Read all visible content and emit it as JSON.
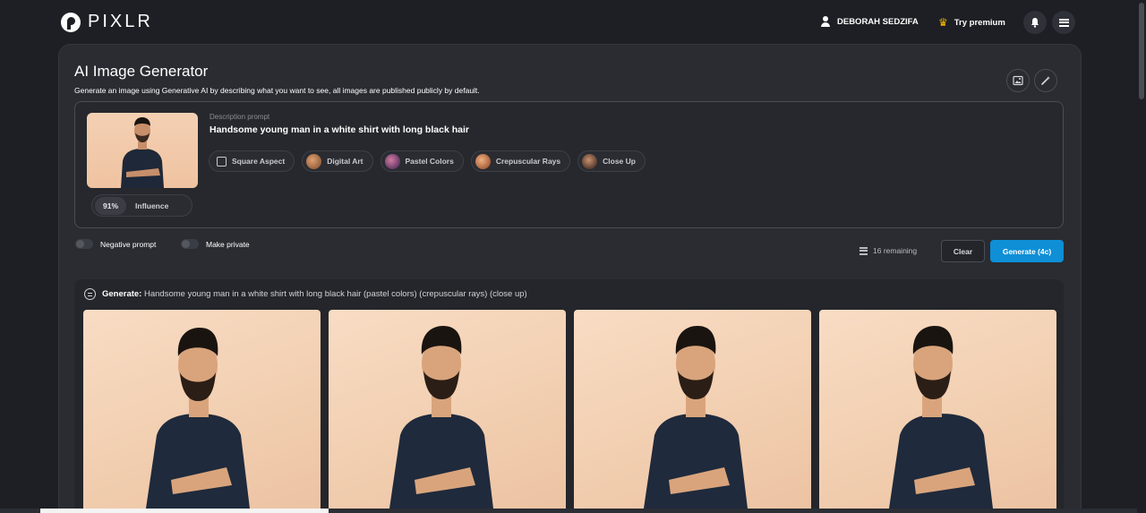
{
  "header": {
    "logo_text": "PIXLR",
    "user_name": "DEBORAH SEDZIFA",
    "premium_label": "Try premium"
  },
  "generator": {
    "title": "AI Image Generator",
    "subtitle": "Generate an image using Generative AI by describing what you want to see, all images are published publicly by default.",
    "description_label": "Description prompt",
    "description_value": "Handsome young man in a white shirt with long black hair",
    "influence_value": "91%",
    "influence_label": "Influence",
    "chips": [
      {
        "label": "Square Aspect",
        "icon": "square-icon"
      },
      {
        "label": "Digital Art",
        "icon": "digital-art-thumb",
        "color": "#b06a3c"
      },
      {
        "label": "Pastel Colors",
        "icon": "pastel-colors-thumb",
        "color": "#6a3c7a"
      },
      {
        "label": "Crepuscular Rays",
        "icon": "crepuscular-rays-thumb",
        "color": "#b8633a"
      },
      {
        "label": "Close Up",
        "icon": "close-up-thumb",
        "color": "#5a3b2e"
      }
    ],
    "negative_prompt_label": "Negative prompt",
    "make_private_label": "Make private",
    "remaining_label": "16 remaining",
    "clear_label": "Clear",
    "generate_label": "Generate (4c)"
  },
  "results": {
    "generate_prefix": "Generate:",
    "generate_text": "Handsome young man in a white shirt with long black hair (pastel colors) (crepuscular rays) (close up)"
  },
  "colors": {
    "accent": "#0e8fd6",
    "background": "#1d1f24",
    "panel": "#2a2c32",
    "crown": "#f5b800"
  }
}
